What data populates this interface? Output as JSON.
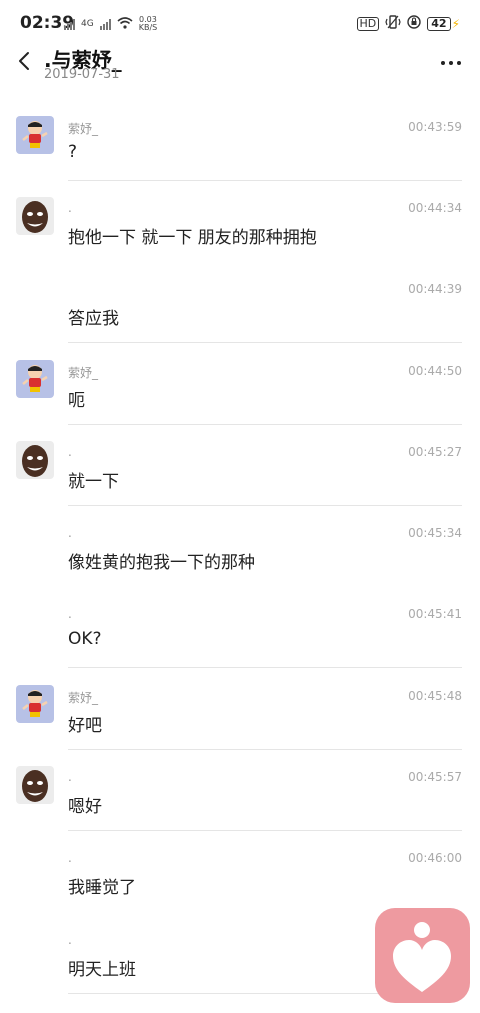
{
  "status_bar": {
    "time": "02:39",
    "net_speed_value": "0.03",
    "net_speed_unit": "KB/S",
    "net_type": "4G",
    "hd_label": "HD",
    "battery": "42"
  },
  "header": {
    "title": ".与萦妤_",
    "date": "2019-07-31"
  },
  "messages": [
    {
      "sender": "萦妤_",
      "time": "00:43:59",
      "text": "?"
    },
    {
      "sender": ".",
      "time": "00:44:34",
      "text": "抱他一下 就一下 朋友的那种拥抱"
    },
    {
      "sender": "",
      "time": "00:44:39",
      "text": "答应我"
    },
    {
      "sender": "萦妤_",
      "time": "00:44:50",
      "text": "呃"
    },
    {
      "sender": ".",
      "time": "00:45:27",
      "text": "就一下"
    },
    {
      "sender": ".",
      "time": "00:45:34",
      "text": "像姓黄的抱我一下的那种"
    },
    {
      "sender": ".",
      "time": "00:45:41",
      "text": "OK?"
    },
    {
      "sender": "萦妤_",
      "time": "00:45:48",
      "text": "好吧"
    },
    {
      "sender": ".",
      "time": "00:45:57",
      "text": "嗯好"
    },
    {
      "sender": ".",
      "time": "00:46:00",
      "text": "我睡觉了"
    },
    {
      "sender": ".",
      "time": "",
      "text": "明天上班"
    }
  ]
}
